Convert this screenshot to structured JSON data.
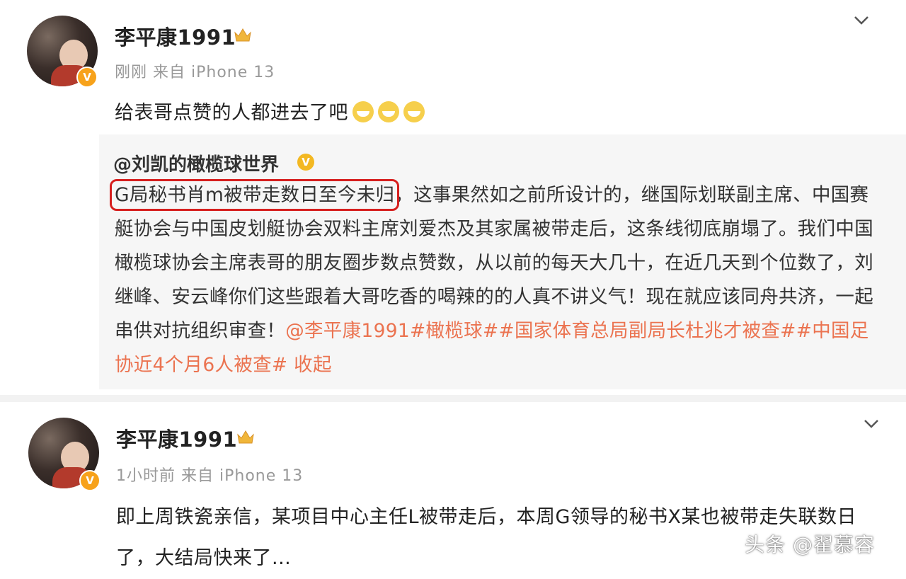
{
  "post1": {
    "username": "李平康1991",
    "time": "刚刚",
    "source": "来自 iPhone 13",
    "text": "给表哥点赞的人都进去了吧",
    "verified_badge": "V",
    "crown_icon": "crown-icon",
    "emoji_icon": "grin-emoji-icon",
    "menu_icon": "chevron-down-icon",
    "repost": {
      "author": "@刘凯的橄榄球世界",
      "verified_badge": "V",
      "highlight_text": "G局秘书肖m被带走数日至今未归",
      "body_after_highlight": "，这事果然如之前所设计的，继国际划联副主席、中国赛艇协会与中国皮划艇协会双料主席刘爱杰及其家属被带走后，这条线彻底崩塌了。我们中国橄榄球协会主席表哥的朋友圈步数点赞数，从以前的每天大几十，在近几天到个位数了，刘继峰、安云峰你们这些跟着大哥吃香的喝辣的的人真不讲义气！现在就应该同舟共济，一起串供对抗组织审查！",
      "mention": "@李平康1991",
      "topics": [
        "#橄榄球#",
        "#国家体育总局副局长杜兆才被查#",
        "#中国足协近4个月6人被查#"
      ],
      "collapse_label": "收起"
    }
  },
  "post2": {
    "username": "李平康1991",
    "time": "1小时前",
    "source": "来自 iPhone 13",
    "text": "即上周铁瓷亲信，某项目中心主任L被带走后，本周G领导的秘书X某也被带走失联数日了，大结局快来了..."
  },
  "watermark": "头条 @翟慕容",
  "colors": {
    "accent_link": "#eb7350",
    "highlight_box": "#d6201f",
    "repost_bg": "#f6f6f6",
    "meta_gray": "#999999"
  }
}
